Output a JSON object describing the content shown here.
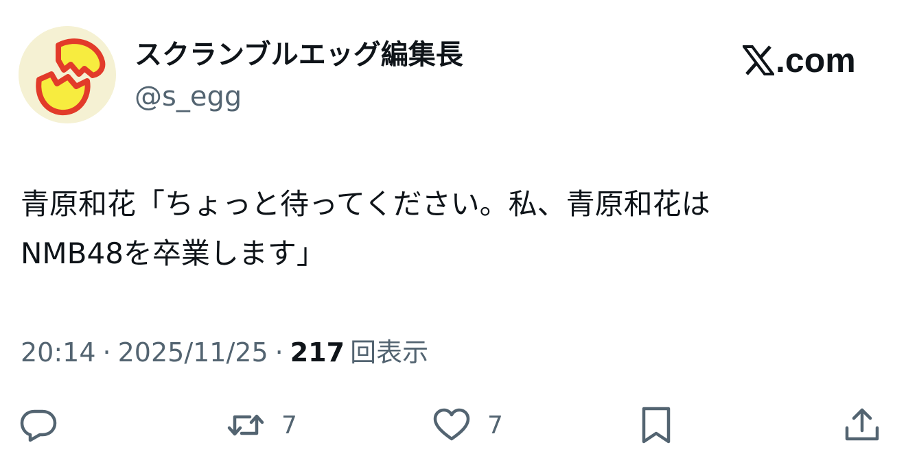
{
  "author": {
    "display_name": "スクランブルエッグ編集長",
    "handle": "@s_egg",
    "avatar_icon": "cracked-egg-icon"
  },
  "brand": {
    "logo_icon": "x-logo-icon",
    "label": ".com"
  },
  "tweet": {
    "text_line1": "青原和花「ちょっと待ってください。私、青原和花は",
    "text_line2": "NMB48を卒業します」"
  },
  "meta": {
    "time": "20:14",
    "separator": "·",
    "date": "2025/11/25",
    "views_count": "217",
    "views_label": "回表示"
  },
  "actions": {
    "reply": {
      "icon": "reply-icon",
      "count": ""
    },
    "repost": {
      "icon": "repost-icon",
      "count": "7"
    },
    "like": {
      "icon": "heart-icon",
      "count": "7"
    },
    "bookmark": {
      "icon": "bookmark-icon",
      "count": ""
    },
    "share": {
      "icon": "share-icon",
      "count": ""
    }
  },
  "colors": {
    "text_primary": "#0f1419",
    "text_secondary": "#536471",
    "avatar_bg": "#f5f1d3",
    "egg_yellow": "#f7ec3f",
    "egg_red": "#e23b2a"
  }
}
